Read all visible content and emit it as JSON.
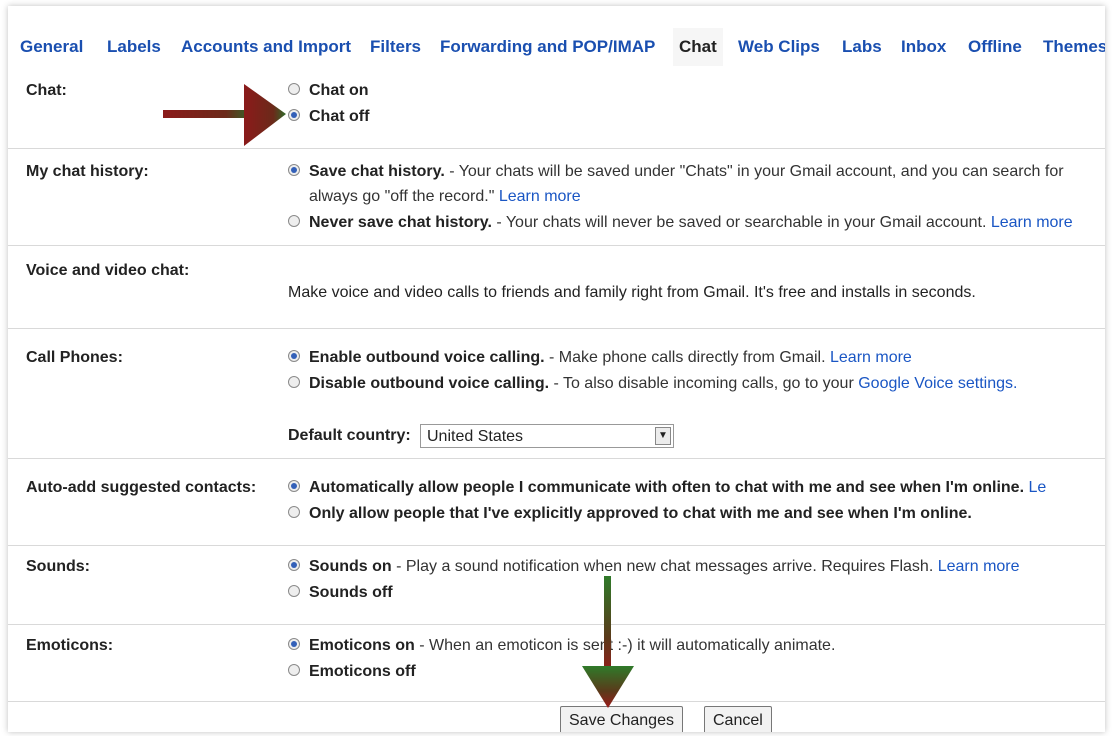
{
  "tabs": [
    "General",
    "Labels",
    "Accounts and Import",
    "Filters",
    "Forwarding and POP/IMAP",
    "Chat",
    "Web Clips",
    "Labs",
    "Inbox",
    "Offline",
    "Themes"
  ],
  "active_tab": "Chat",
  "chat": {
    "label": "Chat:",
    "on": "Chat on",
    "off": "Chat off"
  },
  "history": {
    "label": "My chat history:",
    "save_bold": "Save chat history.",
    "save_desc": " - Your chats will be saved under \"Chats\" in your Gmail account, and you can search for",
    "save_desc2": "always go \"off the record.\" ",
    "learn_more": "Learn more",
    "never_bold": "Never save chat history.",
    "never_desc": " - Your chats will never be saved or searchable in your Gmail account. ",
    "learn_more_cut": "Learn more"
  },
  "voice": {
    "label": "Voice and video chat:",
    "desc": "Make voice and video calls to friends and family right from Gmail. It's free and installs in seconds."
  },
  "phones": {
    "label": "Call Phones:",
    "enable_bold": "Enable outbound voice calling.",
    "enable_desc": " - Make phone calls directly from Gmail. ",
    "learn_more": "Learn more",
    "disable_bold": "Disable outbound voice calling.",
    "disable_desc": " - To also disable incoming calls, go to your ",
    "gv_link": "Google Voice settings.",
    "country_label": "Default country:",
    "country_value": "United States"
  },
  "autoadd": {
    "label": "Auto-add suggested contacts:",
    "auto_bold": "Automatically allow people I communicate with often to chat with me and see when I'm online.",
    "auto_link_cut": " Le",
    "only_bold": "Only allow people that I've explicitly approved to chat with me and see when I'm online."
  },
  "sounds": {
    "label": "Sounds:",
    "on_bold": "Sounds on",
    "on_desc": " - Play a sound notification when new chat messages arrive. Requires Flash. ",
    "learn_more": "Learn more",
    "off": "Sounds off"
  },
  "emoticons": {
    "label": "Emoticons:",
    "on_bold": "Emoticons on",
    "on_desc": " - When an emoticon is sent :-) it will automatically animate.",
    "off": "Emoticons off"
  },
  "buttons": {
    "save": "Save Changes",
    "cancel": "Cancel"
  },
  "colors": {
    "link": "#1a56c4",
    "tab": "#1a4fb0",
    "arrow_red": "#8b1a1a",
    "arrow_green": "#2f6b2a"
  }
}
